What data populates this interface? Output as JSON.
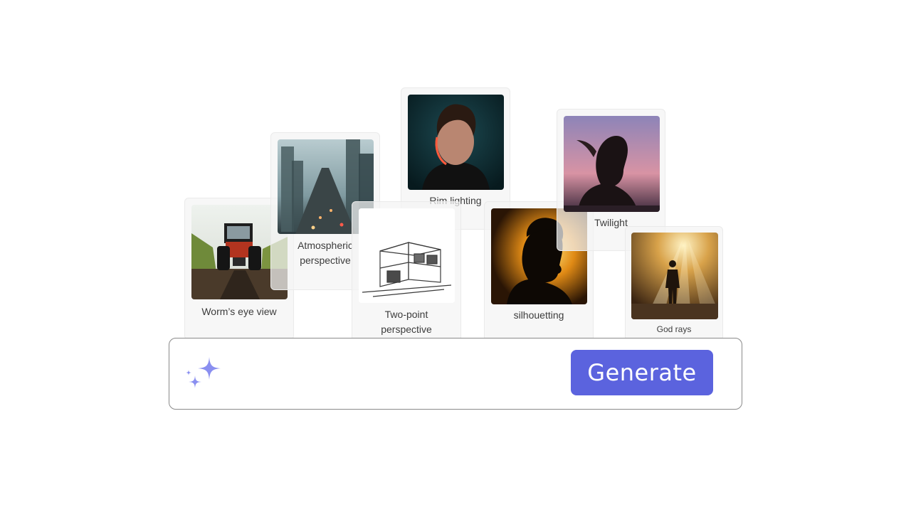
{
  "cards": {
    "worms_eye": {
      "label": "Worm’s eye view",
      "subject": "tractor-image"
    },
    "atmospheric": {
      "label": "Atmospheric\nperspective",
      "subject": "foggy-city-image"
    },
    "rim_lighting": {
      "label": "Rim lighting",
      "subject": "portrait-image"
    },
    "two_point": {
      "label": "Two-point\nperspective",
      "subject": "building-sketch-image"
    },
    "silhouetting": {
      "label": "silhouetting",
      "subject": "silhouette-image"
    },
    "twilight": {
      "label": "Twilight",
      "subject": "twilight-portrait-image"
    },
    "god_rays": {
      "label": "God rays",
      "subject": "sunrays-image"
    }
  },
  "prompt": {
    "icon": "sparkle-icon",
    "generate_label": "Generate"
  },
  "colors": {
    "accent": "#5b63de",
    "sparkle": "#8a8ff0",
    "card_bg": "#f4f4f4",
    "border": "#8a8a8a"
  }
}
